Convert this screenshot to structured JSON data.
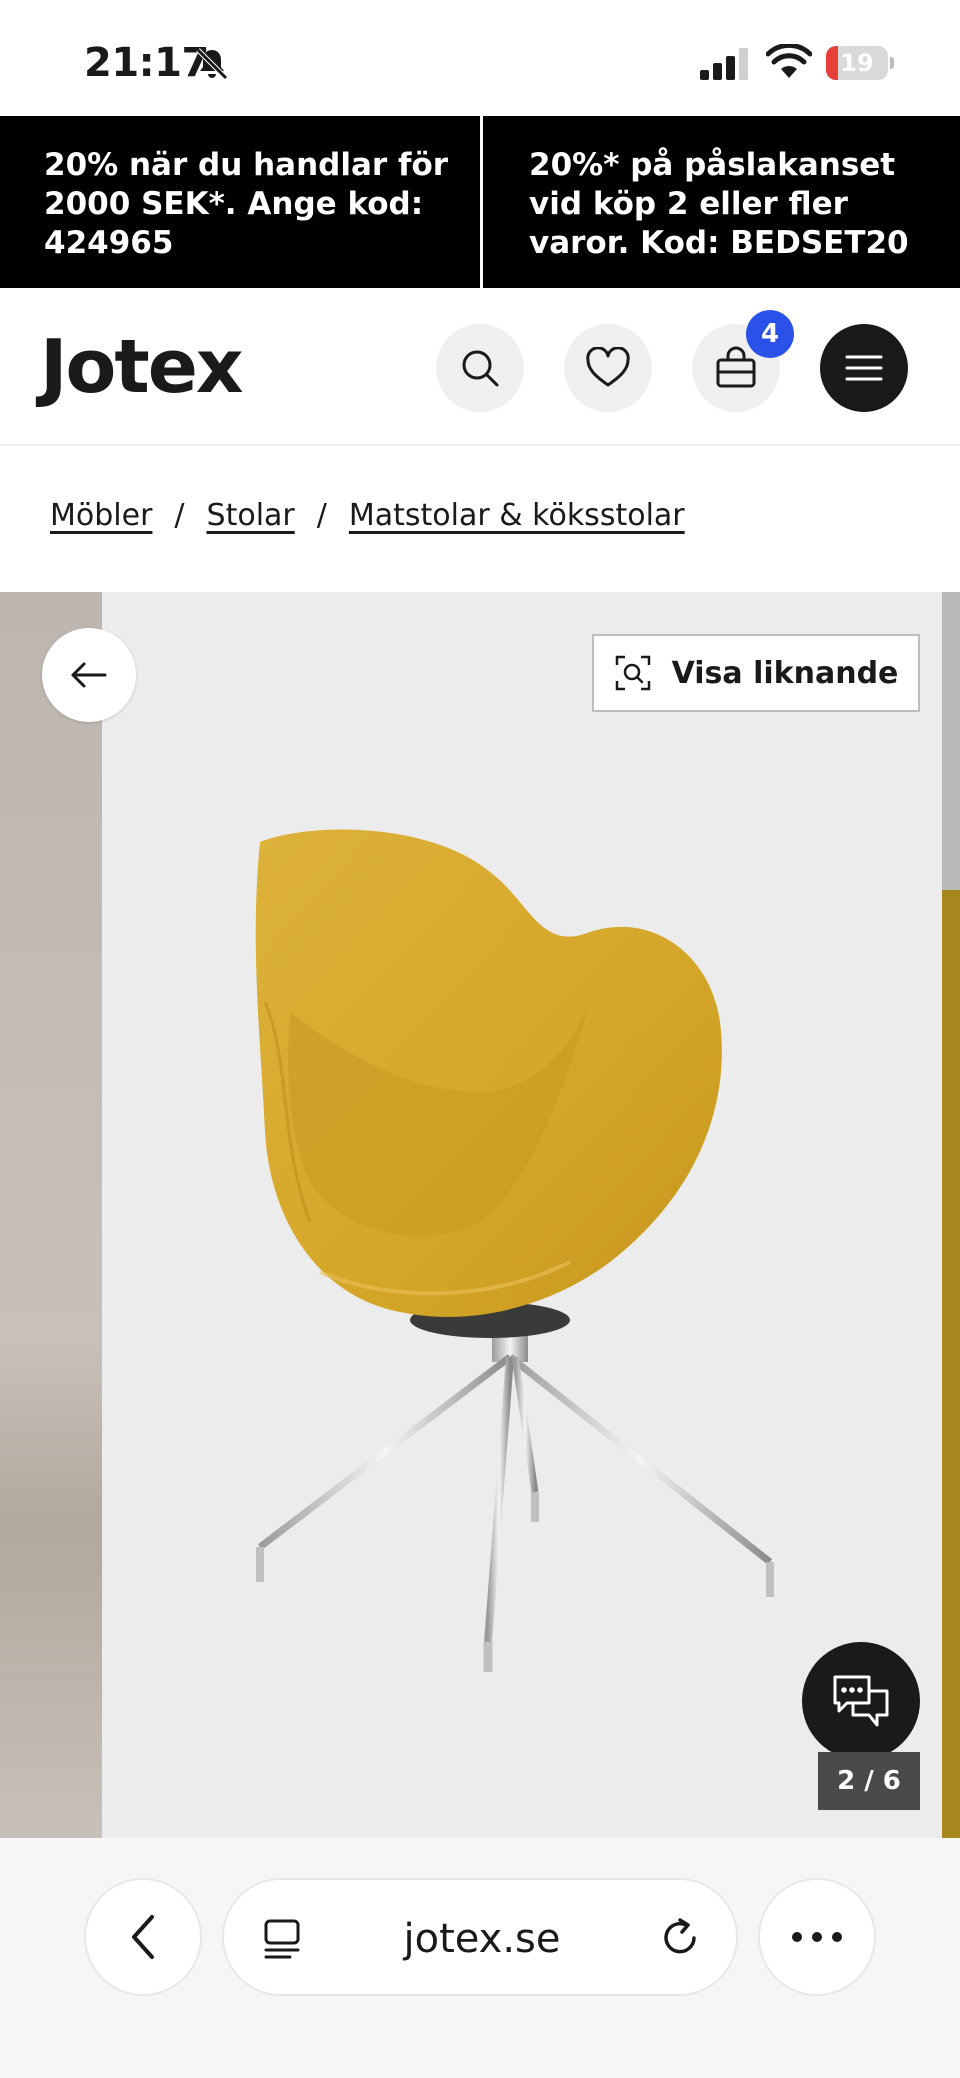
{
  "status_bar": {
    "time": "21:17",
    "battery_level": "19",
    "battery_fraction": 0.19,
    "icons": [
      "bell-slash-icon",
      "cellular-signal-icon",
      "wifi-icon",
      "battery-icon"
    ]
  },
  "promo": {
    "items": [
      {
        "text": "20% när du handlar för 2000 SEK*. Ange kod: 424965"
      },
      {
        "text": "20%* på påslakanset vid köp 2 eller fler varor. Kod: BEDSET20"
      }
    ]
  },
  "header": {
    "logo": "Jotex",
    "cart_count": "4",
    "icons": [
      "search-icon",
      "heart-icon",
      "bag-icon",
      "menu-icon"
    ]
  },
  "breadcrumb": {
    "items": [
      "Möbler",
      "Stolar",
      "Matstolar & köksstolar"
    ],
    "separator": "/"
  },
  "gallery": {
    "similar_label": "Visa liknande",
    "counter": "2 / 6",
    "chair_color": "#d4a628",
    "accent_strip_color": "#a8861e"
  },
  "browser": {
    "url": "jotex.se",
    "icons": [
      "back-chevron-icon",
      "tabs-icon",
      "reload-icon",
      "more-icon"
    ]
  }
}
